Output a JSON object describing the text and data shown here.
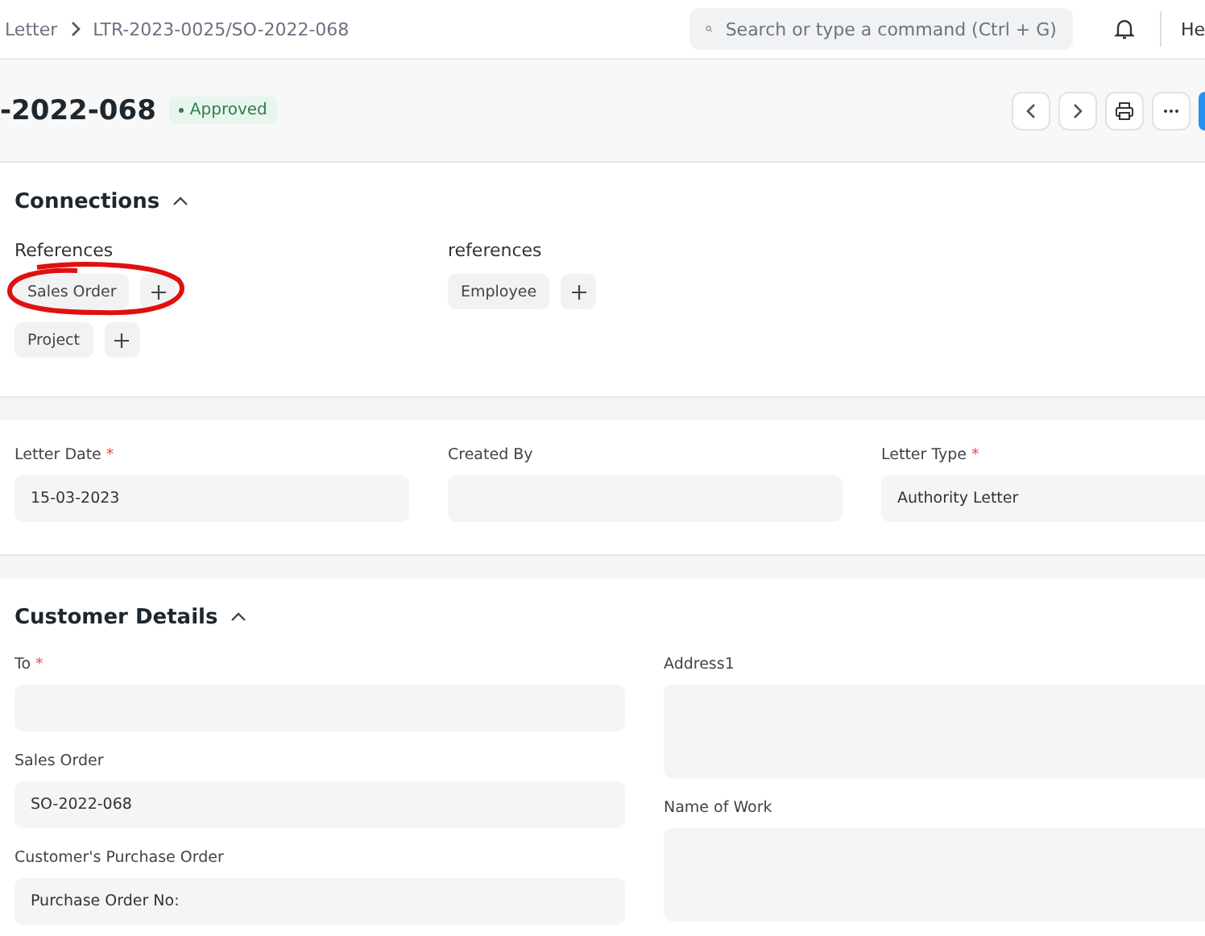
{
  "breadcrumb": [
    "Letter",
    "LTR-2023-0025/SO-2022-068"
  ],
  "search": {
    "placeholder": "Search or type a command (Ctrl + G)"
  },
  "user_menu_label": "He",
  "title": "-2022-068",
  "status": {
    "label": "Approved",
    "color": "#2f7d4f"
  },
  "connections": {
    "title": "Connections",
    "expanded": true,
    "groups": [
      {
        "heading": "References",
        "items": [
          {
            "label": "Sales Order",
            "annotated": true
          },
          {
            "label": "Project",
            "annotated": false
          }
        ]
      },
      {
        "heading": "references",
        "items": [
          {
            "label": "Employee",
            "annotated": false
          }
        ]
      }
    ]
  },
  "letter_fields": [
    {
      "label": "Letter Date",
      "required_mark": "*",
      "value": "15-03-2023"
    },
    {
      "label": "Created By"
    },
    {
      "label": "Letter Type",
      "required_mark": "*",
      "value": "Authority Letter"
    }
  ],
  "customer": {
    "title": "Customer Details",
    "expanded": true,
    "columns": [
      [
        {
          "label": "To",
          "required_mark": "*",
          "kind": "line"
        },
        {
          "label": "Sales Order",
          "value": "SO-2022-068",
          "kind": "line"
        },
        {
          "label": "Customer's Purchase Order",
          "value": "Purchase Order No:",
          "kind": "line"
        }
      ],
      [
        {
          "label": "Address1",
          "kind": "area"
        },
        {
          "label": "Name of Work",
          "kind": "area"
        }
      ]
    ]
  }
}
